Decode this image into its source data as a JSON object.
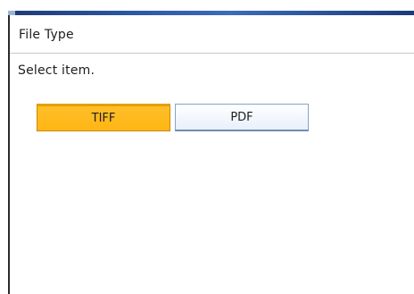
{
  "header": {
    "title": "File Type"
  },
  "main": {
    "prompt": "Select item.",
    "options": [
      {
        "label": "TIFF",
        "selected": true
      },
      {
        "label": "PDF",
        "selected": false
      }
    ]
  },
  "colors": {
    "selected_fill": "#ffb514",
    "unselected_fill": "#e8f0fb",
    "title_bar": "#2c57a3"
  }
}
